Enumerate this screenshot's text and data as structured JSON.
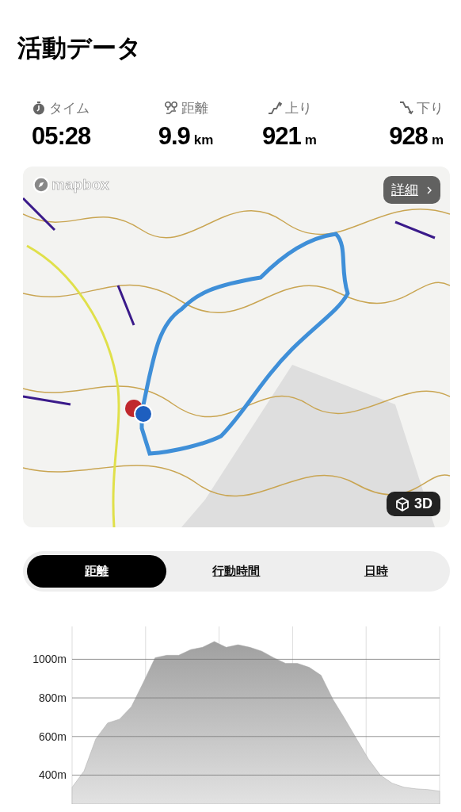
{
  "title": "活動データ",
  "stats": [
    {
      "kind": "time",
      "label": "タイム",
      "value": "05:28"
    },
    {
      "kind": "distance",
      "label": "距離",
      "value": "9.9",
      "unit": "km"
    },
    {
      "kind": "ascent",
      "label": "上り",
      "value": "921",
      "unit": "m"
    },
    {
      "kind": "descent",
      "label": "下り",
      "value": "928",
      "unit": "m"
    }
  ],
  "map": {
    "kind": "picture",
    "attribution": "mapbox",
    "details_button": "詳細",
    "view_3d_button": "3D"
  },
  "tabs": [
    {
      "label": "距離",
      "selected": true
    },
    {
      "label": "行動時間",
      "selected": false
    },
    {
      "label": "日時",
      "selected": false
    }
  ],
  "elevation": {
    "chart_data": {
      "type": "area",
      "ylim": [
        250,
        1170
      ],
      "yticks": [
        {
          "value": 400,
          "label": "400m"
        },
        {
          "value": 600,
          "label": "600m"
        },
        {
          "value": 800,
          "label": "800m"
        },
        {
          "value": 1000,
          "label": "1000m"
        }
      ],
      "grid": true,
      "series": [
        {
          "color": "#a8a8a8",
          "values": [
            337,
            420,
            587,
            670,
            690,
            754,
            879,
            1008,
            1021,
            1021,
            1050,
            1062,
            1092,
            1062,
            1075,
            1062,
            1042,
            1008,
            979,
            979,
            958,
            917,
            792,
            692,
            587,
            483,
            400,
            358,
            337,
            329,
            325,
            317
          ]
        }
      ]
    }
  }
}
